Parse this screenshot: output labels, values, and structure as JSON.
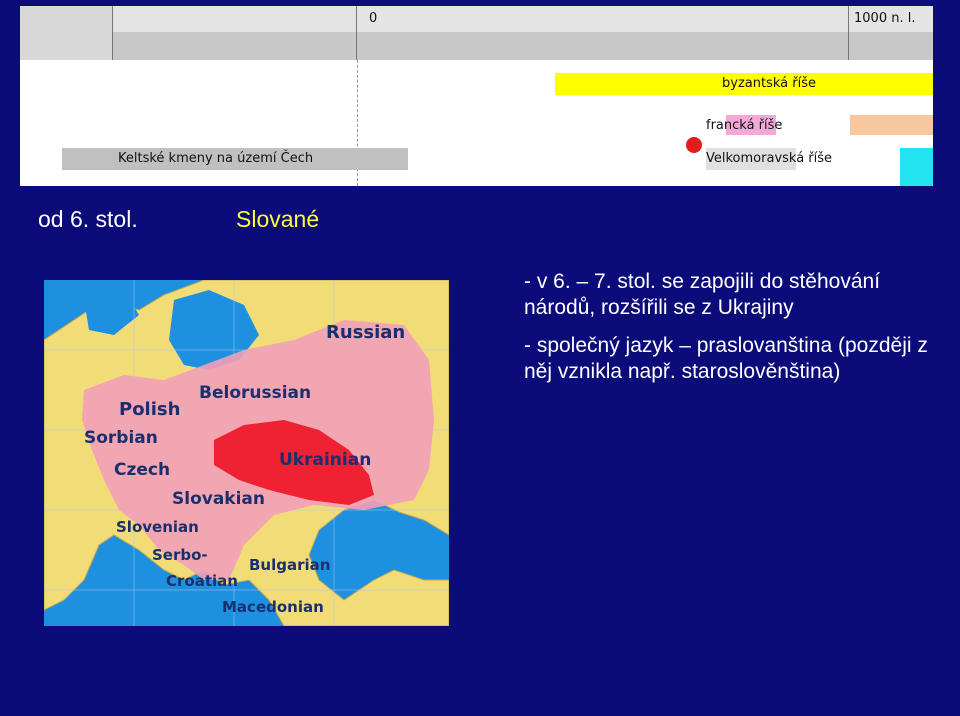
{
  "timeline": {
    "tick_zero": "0",
    "tick_1000": "1000 n. l.",
    "bars": {
      "byzantine": "byzantská říše",
      "frankish": "francká říše",
      "great_moravia": "Velkomoravská říše",
      "celtic": "Keltské kmeny na území Čech"
    },
    "colors": {
      "byzantine": "#ffff00",
      "frankish": "#f4a8d8",
      "peach": "#f8c79e",
      "cyan": "#22e4f0",
      "celtic": "#c0c0c0",
      "dot": "#e21b1b"
    }
  },
  "heading": {
    "left": "od 6. stol.",
    "right": "Slované"
  },
  "map": {
    "labels": {
      "russian": "Russian",
      "belorussian": "Belorussian",
      "polish": "Polish",
      "sorbian": "Sorbian",
      "czech": "Czech",
      "ukrainian": "Ukrainian",
      "slovakian": "Slovakian",
      "slovenian": "Slovenian",
      "serbo": "Serbo-",
      "croatian": "Croatian",
      "bulgarian": "Bulgarian",
      "macedonian": "Macedonian"
    },
    "colors": {
      "sea": "#1e90e0",
      "land": "#f2dc78",
      "slavic": "#f2a0b8",
      "core": "#ee2233",
      "label": "#1a2f6e"
    }
  },
  "text": {
    "para1": "- v 6. – 7. stol. se zapojili do stěhování národů, rozšířili se z Ukrajiny",
    "para2": "- společný jazyk – praslovanština (později z něj vznikla např. staroslověnština)"
  }
}
